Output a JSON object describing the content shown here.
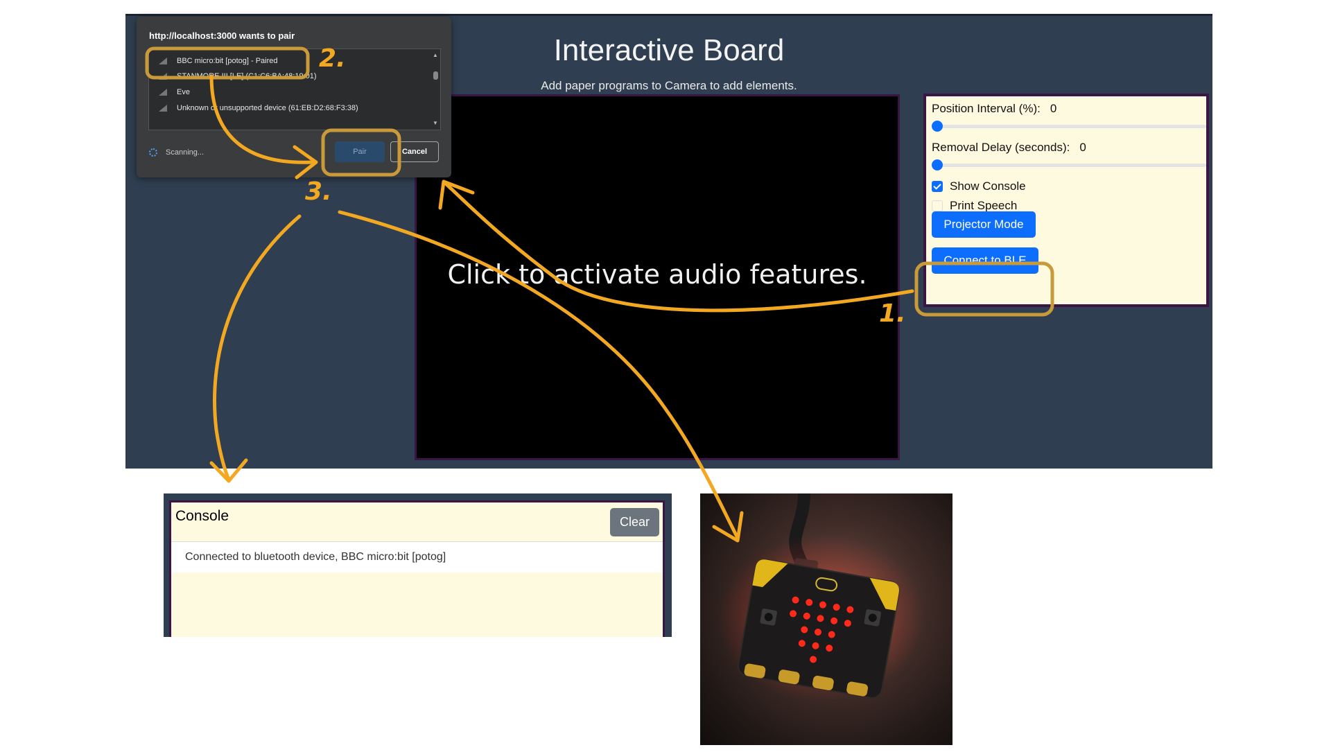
{
  "app": {
    "title": "Interactive Board",
    "subtitle": "Add paper programs to Camera to add elements.",
    "canvas_message": "Click to activate audio features."
  },
  "controls": {
    "position_interval_label": "Position Interval (%):",
    "position_interval_value": "0",
    "position_interval_fraction": 0,
    "removal_delay_label": "Removal Delay (seconds):",
    "removal_delay_value": "0",
    "removal_delay_fraction": 0,
    "show_console_label": "Show Console",
    "show_console_checked": true,
    "print_speech_label": "Print Speech",
    "print_speech_checked": false,
    "projector_mode_label": "Projector Mode",
    "connect_ble_label": "Connect to BLE"
  },
  "pair_dialog": {
    "title": "http://localhost:3000 wants to pair",
    "devices": [
      {
        "label": "BBC micro:bit [potog] - Paired"
      },
      {
        "label": "STANMORE III [LE] (C1:C6:BA:48:19:01)"
      },
      {
        "label": "Eve"
      },
      {
        "label": "Unknown or unsupported device (61:EB:D2:68:F3:38)"
      }
    ],
    "scanning_label": "Scanning...",
    "pair_label": "Pair",
    "cancel_label": "Cancel"
  },
  "console": {
    "title": "Console",
    "clear_label": "Clear",
    "lines": [
      "Connected to bluetooth device, BBC micro:bit [potog]"
    ]
  },
  "annotations": {
    "step1": "1.",
    "step2": "2.",
    "step3": "3."
  },
  "colors": {
    "app_background": "#2f3f51",
    "panel_background": "#fefadf",
    "panel_border": "#3b1644",
    "primary_button": "#0d6efd",
    "secondary_button": "#6c757d",
    "annotation": "#f3a821",
    "annotation_box": "#c99a3a"
  }
}
